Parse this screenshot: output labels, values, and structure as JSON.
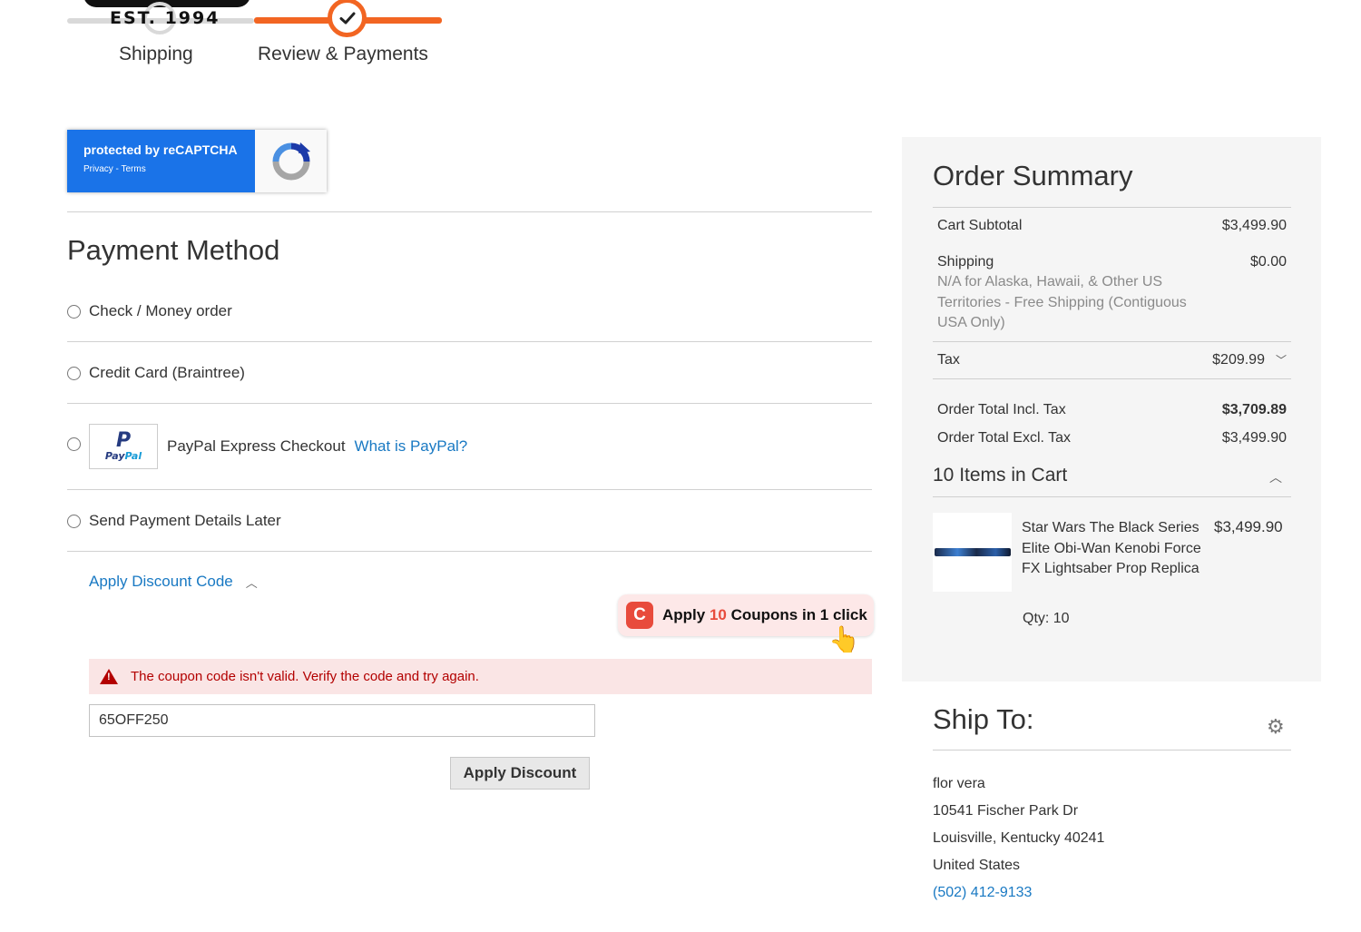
{
  "progress": {
    "logo_text": "EST. 1994",
    "steps": [
      {
        "label": "Shipping"
      },
      {
        "label": "Review & Payments"
      }
    ]
  },
  "recaptcha": {
    "line1": "protected by reCAPTCHA",
    "line2": "Privacy - Terms"
  },
  "payment": {
    "title": "Payment Method",
    "options": [
      {
        "label": "Check / Money order"
      },
      {
        "label": "Credit Card (Braintree)"
      },
      {
        "label": "PayPal Express Checkout",
        "link": "What is PayPal?"
      },
      {
        "label": "Send Payment Details Later"
      }
    ],
    "paypal_logo_word_1": "Pay",
    "paypal_logo_word_2": "Pal"
  },
  "discount": {
    "toggle_label": "Apply Discount Code",
    "coupon_ext": {
      "prefix": "Apply ",
      "count": "10",
      "suffix": " Coupons in 1 click"
    },
    "error": "The coupon code isn't valid. Verify the code and try again.",
    "code_value": "65OFF250",
    "apply_label": "Apply Discount"
  },
  "summary": {
    "title": "Order Summary",
    "rows": {
      "subtotal_label": "Cart Subtotal",
      "subtotal_value": "$3,499.90",
      "shipping_label": "Shipping",
      "shipping_value": "$0.00",
      "shipping_note": "N/A for Alaska, Hawaii, & Other US Territories - Free Shipping (Contiguous USA Only)",
      "tax_label": "Tax",
      "tax_value": "$209.99",
      "total_incl_label": "Order Total Incl. Tax",
      "total_incl_value": "$3,709.89",
      "total_excl_label": "Order Total Excl. Tax",
      "total_excl_value": "$3,499.90"
    },
    "items_header": "10 Items in Cart",
    "item": {
      "name": "Star Wars The Black Series Elite Obi-Wan Kenobi Force FX Lightsaber Prop Replica",
      "price": "$3,499.90",
      "qty": "Qty: 10"
    }
  },
  "ship_to": {
    "title": "Ship To:",
    "name": "flor vera",
    "street": "10541 Fischer Park Dr",
    "city_line": "Louisville, Kentucky 40241",
    "country": "United States",
    "phone": "(502) 412-9133"
  },
  "colors": {
    "accent": "#f26522",
    "link": "#1979c3",
    "error": "#b30000",
    "recaptcha_blue": "#1a73e8"
  }
}
